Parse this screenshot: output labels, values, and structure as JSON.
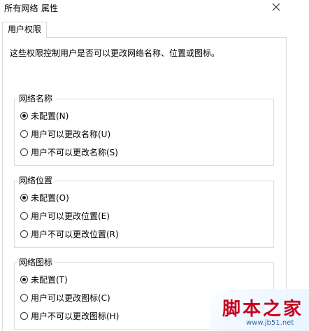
{
  "window": {
    "title": "所有网络 属性",
    "close_icon": "close-icon"
  },
  "tabs": [
    {
      "label": "用户权限",
      "selected": true
    }
  ],
  "description": "这些权限控制用户是否可以更改网络名称、位置或图标。",
  "groups": [
    {
      "legend": "网络名称",
      "options": [
        {
          "label": "未配置(N)",
          "checked": true
        },
        {
          "label": "用户可以更改名称(U)",
          "checked": false
        },
        {
          "label": "用户不可以更改名称(S)",
          "checked": false
        }
      ]
    },
    {
      "legend": "网络位置",
      "options": [
        {
          "label": "未配置(O)",
          "checked": true
        },
        {
          "label": "用户可以更改位置(E)",
          "checked": false
        },
        {
          "label": "用户不可以更改位置(R)",
          "checked": false
        }
      ]
    },
    {
      "legend": "网络图标",
      "options": [
        {
          "label": "未配置(T)",
          "checked": true
        },
        {
          "label": "用户可以更改图标(C)",
          "checked": false
        },
        {
          "label": "用户不可以更改图标(H)",
          "checked": false
        }
      ]
    }
  ],
  "watermark": {
    "brand": "脚本之家",
    "url": "www.jb51.net"
  },
  "colors": {
    "border": "#d9d9d9",
    "watermark_red": "#c8001e",
    "watermark_blue": "#2d5fa8"
  }
}
